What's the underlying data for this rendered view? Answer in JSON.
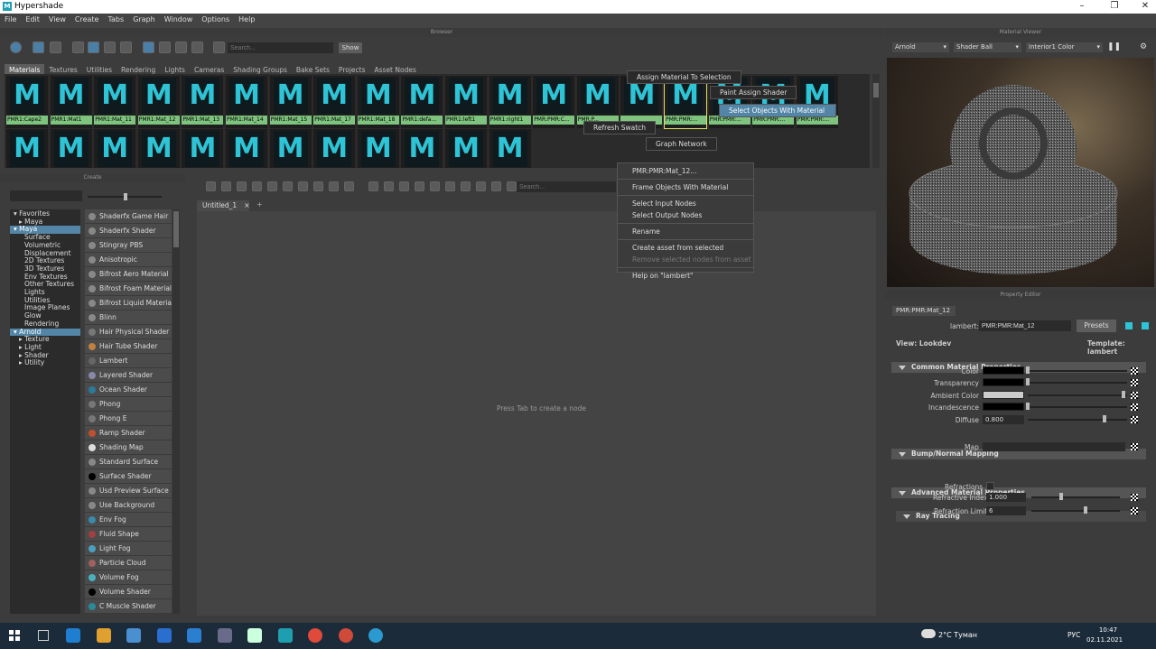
{
  "app": {
    "title": "Hypershade",
    "logo": "M"
  },
  "menu": [
    "File",
    "Edit",
    "View",
    "Create",
    "Tabs",
    "Graph",
    "Window",
    "Options",
    "Help"
  ],
  "browser": {
    "header": "Browser",
    "search_placeholder": "Search...",
    "show_label": "Show",
    "tabs": [
      "Materials",
      "Textures",
      "Utilities",
      "Rendering",
      "Lights",
      "Cameras",
      "Shading Groups",
      "Bake Sets",
      "Projects",
      "Asset Nodes"
    ],
    "swatches_row1": [
      "PMR1:Cape2",
      "PMR1:Mat1",
      "PMR1:Mat_11",
      "PMR1:Mat_12",
      "PMR1:Mat_13",
      "PMR1:Mat_14",
      "PMR1:Mat_15",
      "PMR1:Mat_17",
      "PMR1:Mat_18",
      "PMR1:defa...",
      "PMR1:left1",
      "PMR1:right1",
      "PMR:PMR:C...",
      "PMR:P...",
      "",
      "PMR:PMR:...",
      "PMR:PMR:...",
      "PMR:PMR:...",
      "PMR:PMR:..."
    ],
    "swatch_glyph": "M",
    "row2_count": 12
  },
  "marking_menu": {
    "assign": "Assign Material To Selection",
    "paint": "Paint Assign Shader",
    "select": "Select Objects With Material",
    "refresh": "Refresh Swatch",
    "graph": "Graph Network"
  },
  "context_menu": {
    "items": [
      "PMR:PMR:Mat_12...",
      "Frame Objects With Material",
      "Select Input Nodes",
      "Select Output Nodes",
      "Rename",
      "Create asset from selected",
      "Remove selected nodes from asset",
      "Help on \"lambert\""
    ]
  },
  "create": {
    "header": "Create",
    "tree": [
      "Favorites",
      "Maya",
      "Maya",
      "Surface",
      "Volumetric",
      "Displacement",
      "2D Textures",
      "3D Textures",
      "Env Textures",
      "Other Textures",
      "Lights",
      "Utilities",
      "Image Planes",
      "Glow",
      "Rendering",
      "Arnold",
      "Texture",
      "Light",
      "Shader",
      "Utility"
    ],
    "shaders": [
      {
        "name": "Shaderfx Game Hair",
        "color": "#888"
      },
      {
        "name": "Shaderfx Shader",
        "color": "#888"
      },
      {
        "name": "Stingray PBS",
        "color": "#888"
      },
      {
        "name": "Anisotropic",
        "color": "#888"
      },
      {
        "name": "Bifrost Aero Material",
        "color": "#888"
      },
      {
        "name": "Bifrost Foam Material",
        "color": "#888"
      },
      {
        "name": "Bifrost Liquid Material",
        "color": "#888"
      },
      {
        "name": "Blinn",
        "color": "#888"
      },
      {
        "name": "Hair Physical Shader",
        "color": "#777"
      },
      {
        "name": "Hair Tube Shader",
        "color": "#c08040"
      },
      {
        "name": "Lambert",
        "color": "#666"
      },
      {
        "name": "Layered Shader",
        "color": "#8888aa"
      },
      {
        "name": "Ocean Shader",
        "color": "#2a7a9a"
      },
      {
        "name": "Phong",
        "color": "#777"
      },
      {
        "name": "Phong E",
        "color": "#777"
      },
      {
        "name": "Ramp Shader",
        "color": "#c05030"
      },
      {
        "name": "Shading Map",
        "color": "#ddd"
      },
      {
        "name": "Standard Surface",
        "color": "#888"
      },
      {
        "name": "Surface Shader",
        "color": "#000"
      },
      {
        "name": "Usd Preview Surface",
        "color": "#888"
      },
      {
        "name": "Use Background",
        "color": "#888"
      },
      {
        "name": "Env Fog",
        "color": "#3a8aaa"
      },
      {
        "name": "Fluid Shape",
        "color": "#a04040"
      },
      {
        "name": "Light Fog",
        "color": "#4aa0c0"
      },
      {
        "name": "Particle Cloud",
        "color": "#a06060"
      },
      {
        "name": "Volume Fog",
        "color": "#4ab0c0"
      },
      {
        "name": "Volume Shader",
        "color": "#000"
      },
      {
        "name": "C Muscle Shader",
        "color": "#2a8a9a"
      }
    ]
  },
  "graph": {
    "search_placeholder": "Search...",
    "tab": "Untitled_1",
    "add_tab": "+",
    "hint": "Press Tab to create a node"
  },
  "viewer": {
    "header": "Material Viewer",
    "renderer": "Arnold",
    "geometry": "Shader Ball",
    "env": "Interior1 Color"
  },
  "prop": {
    "header": "Property Editor",
    "tab": "PMR:PMR:Mat_12",
    "type_label": "lambert:",
    "name": "PMR:PMR:Mat_12",
    "presets": "Presets",
    "view": "View: Lookdev",
    "template": "Template: lambert",
    "sections": {
      "common": "Common Material Properties",
      "bump": "Bump/Normal Mapping",
      "advanced": "Advanced Material Properties",
      "ray": "Ray Tracing"
    },
    "attrs": {
      "color": "Color",
      "transparency": "Transparency",
      "ambient": "Ambient Color",
      "incandescence": "Incandescence",
      "diffuse": "Diffuse",
      "diffuse_val": "0.800",
      "map": "Map",
      "refractions": "Refractions",
      "refr_index": "Refractive Index",
      "refr_index_val": "1.000",
      "refr_limit": "Refraction Limit",
      "refr_limit_val": "6"
    }
  },
  "taskbar": {
    "weather": "2°C Туман",
    "lang": "РУС",
    "time": "10:47",
    "date": "02.11.2021"
  }
}
